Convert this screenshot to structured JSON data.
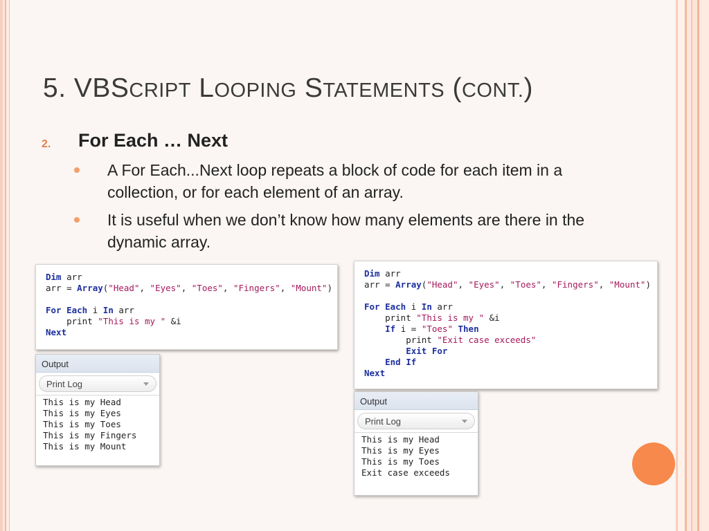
{
  "title": {
    "prefix": "5. VBS",
    "s1": "cript",
    "l": "L",
    "s2": "ooping",
    "st": "S",
    "s3": "tatements",
    "paren_open": "(",
    "s4": "cont.",
    "paren_close": ")"
  },
  "item": {
    "number": "2.",
    "heading": "For Each … Next"
  },
  "bullets": [
    {
      "text": "A For Each...Next loop repeats a block of code for each item in a collection, or for each element of an array."
    },
    {
      "text": "It is useful when we don’t know how many elements are there in the dynamic array."
    }
  ],
  "example1": {
    "code": [
      [
        {
          "t": "Dim",
          "k": "kw"
        },
        {
          "t": " arr",
          "k": ""
        }
      ],
      [
        {
          "t": "arr = ",
          "k": ""
        },
        {
          "t": "Array",
          "k": "kw"
        },
        {
          "t": "(",
          "k": ""
        },
        {
          "t": "\"Head\"",
          "k": "str"
        },
        {
          "t": ", ",
          "k": ""
        },
        {
          "t": "\"Eyes\"",
          "k": "str"
        },
        {
          "t": ", ",
          "k": ""
        },
        {
          "t": "\"Toes\"",
          "k": "str"
        },
        {
          "t": ", ",
          "k": ""
        },
        {
          "t": "\"Fingers\"",
          "k": "str"
        },
        {
          "t": ", ",
          "k": ""
        },
        {
          "t": "\"Mount\"",
          "k": "str"
        },
        {
          "t": ")",
          "k": ""
        }
      ],
      [],
      [
        {
          "t": "For Each",
          "k": "kw"
        },
        {
          "t": " i ",
          "k": ""
        },
        {
          "t": "In",
          "k": "kw"
        },
        {
          "t": " arr",
          "k": ""
        }
      ],
      [
        {
          "t": "    print ",
          "k": ""
        },
        {
          "t": "\"This is my \"",
          "k": "str"
        },
        {
          "t": " &i",
          "k": ""
        }
      ],
      [
        {
          "t": "Next",
          "k": "kw"
        }
      ]
    ],
    "output": {
      "header": "Output",
      "select": "Print Log",
      "lines": [
        "This is my Head",
        "This is my Eyes",
        "This is my Toes",
        "This is my Fingers",
        "This is my Mount"
      ]
    }
  },
  "example2": {
    "code": [
      [
        {
          "t": "Dim",
          "k": "kw"
        },
        {
          "t": " arr",
          "k": ""
        }
      ],
      [
        {
          "t": "arr = ",
          "k": ""
        },
        {
          "t": "Array",
          "k": "kw"
        },
        {
          "t": "(",
          "k": ""
        },
        {
          "t": "\"Head\"",
          "k": "str"
        },
        {
          "t": ", ",
          "k": ""
        },
        {
          "t": "\"Eyes\"",
          "k": "str"
        },
        {
          "t": ", ",
          "k": ""
        },
        {
          "t": "\"Toes\"",
          "k": "str"
        },
        {
          "t": ", ",
          "k": ""
        },
        {
          "t": "\"Fingers\"",
          "k": "str"
        },
        {
          "t": ", ",
          "k": ""
        },
        {
          "t": "\"Mount\"",
          "k": "str"
        },
        {
          "t": ")",
          "k": ""
        }
      ],
      [],
      [
        {
          "t": "For Each",
          "k": "kw"
        },
        {
          "t": " i ",
          "k": ""
        },
        {
          "t": "In",
          "k": "kw"
        },
        {
          "t": " arr",
          "k": ""
        }
      ],
      [
        {
          "t": "    print ",
          "k": ""
        },
        {
          "t": "\"This is my \"",
          "k": "str"
        },
        {
          "t": " &i",
          "k": ""
        }
      ],
      [
        {
          "t": "    ",
          "k": ""
        },
        {
          "t": "If",
          "k": "kw"
        },
        {
          "t": " i = ",
          "k": ""
        },
        {
          "t": "\"Toes\"",
          "k": "str"
        },
        {
          "t": " ",
          "k": ""
        },
        {
          "t": "Then",
          "k": "kw"
        }
      ],
      [
        {
          "t": "        print ",
          "k": ""
        },
        {
          "t": "\"Exit case exceeds\"",
          "k": "str"
        }
      ],
      [
        {
          "t": "        ",
          "k": ""
        },
        {
          "t": "Exit For",
          "k": "kw"
        }
      ],
      [
        {
          "t": "    ",
          "k": ""
        },
        {
          "t": "End If",
          "k": "kw"
        }
      ],
      [
        {
          "t": "Next",
          "k": "kw"
        }
      ]
    ],
    "output": {
      "header": "Output",
      "select": "Print Log",
      "lines": [
        "This is my Head",
        "This is my Eyes",
        "This is my Toes",
        "Exit case exceeds"
      ]
    }
  },
  "colors": {
    "accent": "#f7894c",
    "keyword": "#1d2f9f",
    "string": "#a3195b",
    "number": "#e07f4e"
  }
}
